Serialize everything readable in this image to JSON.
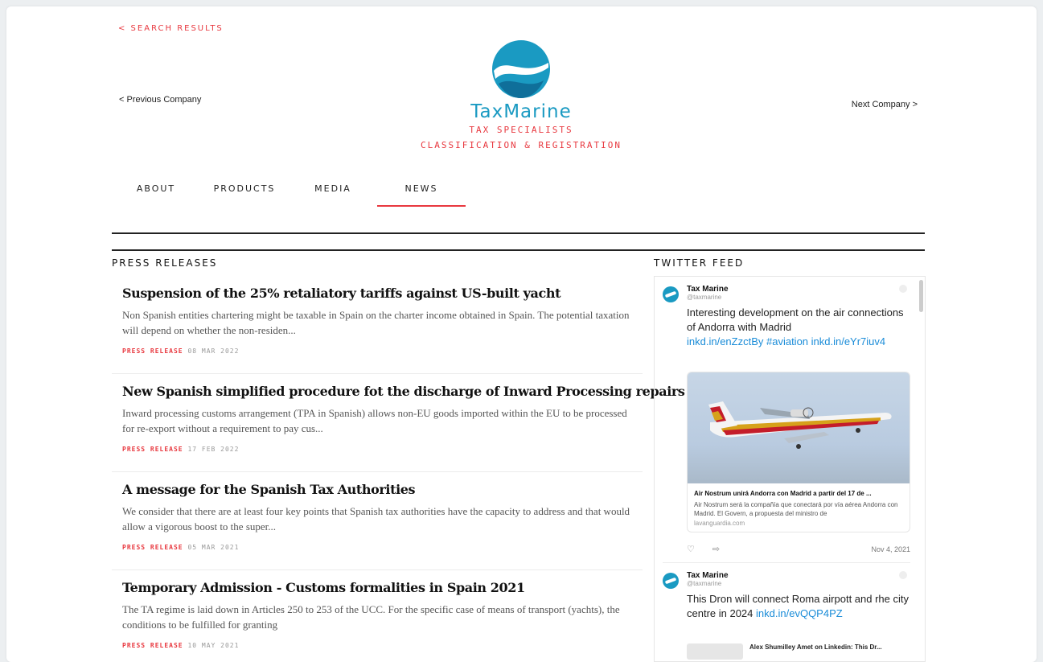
{
  "nav": {
    "back_label": "< SEARCH RESULTS",
    "prev_label": "< Previous Company",
    "next_label": "Next Company >"
  },
  "brand": {
    "name": "TaxMarine",
    "tagline_1": "TAX SPECIALISTS",
    "tagline_2": "CLASSIFICATION & REGISTRATION",
    "accent_color": "#e8383f",
    "brand_color": "#1a9ac2"
  },
  "tabs": [
    {
      "label": "ABOUT",
      "active": false
    },
    {
      "label": "PRODUCTS",
      "active": false
    },
    {
      "label": "MEDIA",
      "active": false
    },
    {
      "label": "NEWS",
      "active": true
    }
  ],
  "press": {
    "section_title": "PRESS RELEASES",
    "articles": [
      {
        "title": "Suspension of the 25% retaliatory tariffs against US-built yacht",
        "excerpt": "Non Spanish entities chartering might be taxable in Spain on the charter income obtained in Spain. The potential taxation will depend on whether the non-residen...",
        "kind": "PRESS RELEASE",
        "date": "08 MAR 2022"
      },
      {
        "title": "New Spanish simplified procedure fot the discharge of Inward Processing repairs",
        "excerpt": "Inward processing customs arrangement (TPA in Spanish) allows non-EU goods imported within the EU to be processed for re-export without a requirement to pay cus...",
        "kind": "PRESS RELEASE",
        "date": "17 FEB 2022"
      },
      {
        "title": "A message for the Spanish Tax Authorities",
        "excerpt": "We consider that there are at least four key points that Spanish tax authorities have the capacity to address and that would allow a vigorous boost to the super...",
        "kind": "PRESS RELEASE",
        "date": "05 MAR 2021"
      },
      {
        "title": "Temporary Admission - Customs formalities in Spain 2021",
        "excerpt": "The TA regime is laid down in Articles 250 to 253 of the UCC. For the specific case of means of transport (yachts), the conditions to be fulfilled for granting",
        "kind": "PRESS RELEASE",
        "date": "10 MAY 2021"
      }
    ]
  },
  "twitter": {
    "section_title": "TWITTER FEED",
    "tweets": [
      {
        "name": "Tax Marine",
        "handle": "@taxmarine",
        "text": "Interesting development on the air connections of Andorra with Madrid",
        "links": "inkd.in/enZzctBy #aviation inkd.in/eYr7iuv4",
        "card_title": "Air Nostrum unirá Andorra con Madrid a partir del 17 de ...",
        "card_desc": "Air Nostrum será la compañía que conectará por vía aérea Andorra con Madrid. El Govern, a propuesta del ministro de",
        "card_domain": "lavanguardia.com",
        "date": "Nov 4, 2021"
      },
      {
        "name": "Tax Marine",
        "handle": "@taxmarine",
        "text": "This Dron will connect Roma airpott and rhe city centre in 2024",
        "links": "inkd.in/evQQP4PZ",
        "card_title": "Alex Shumilley Amet on Linkedin: This Dr..."
      }
    ]
  }
}
